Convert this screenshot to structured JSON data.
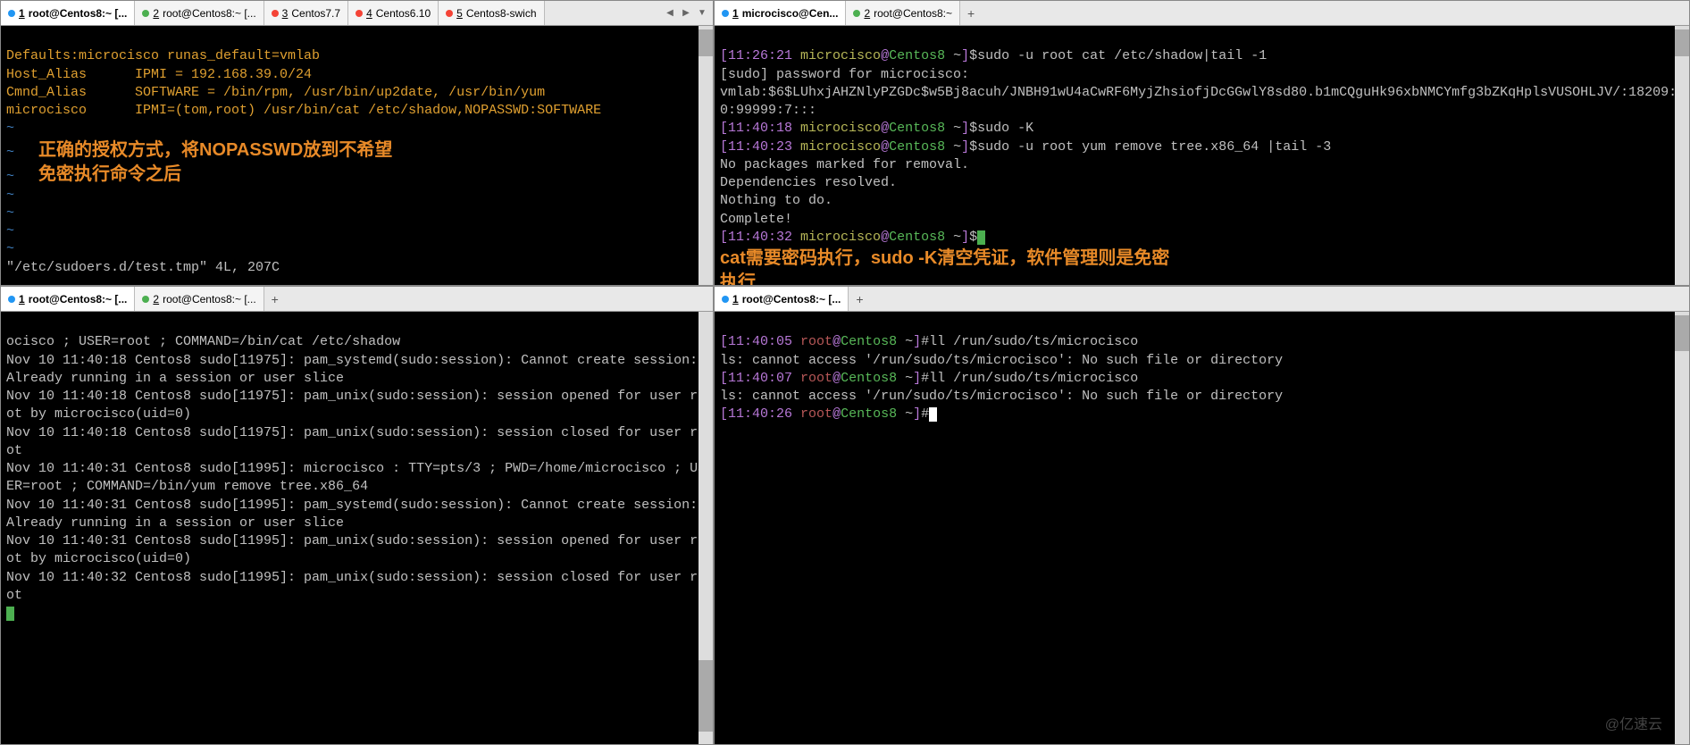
{
  "panes": {
    "tl": {
      "tabs": [
        {
          "dot": "blue",
          "num": "1",
          "label": "root@Centos8:~ [...",
          "active": true
        },
        {
          "dot": "green",
          "num": "2",
          "label": "root@Centos8:~ [..."
        },
        {
          "dot": "red",
          "num": "3",
          "label": "Centos7.7"
        },
        {
          "dot": "red",
          "num": "4",
          "label": "Centos6.10"
        },
        {
          "dot": "red",
          "num": "5",
          "label": "Centos8-swich"
        }
      ],
      "line1": "Defaults:microcisco runas_default=vmlab",
      "line2": "Host_Alias      IPMI = 192.168.39.0/24",
      "line3": "Cmnd_Alias      SOFTWARE = /bin/rpm, /usr/bin/up2date, /usr/bin/yum",
      "line4": "microcisco      IPMI=(tom,root) /usr/bin/cat /etc/shadow,NOPASSWD:SOFTWARE",
      "overlay1": "正确的授权方式，将NOPASSWD放到不希望",
      "overlay2": "免密执行命令之后",
      "footer": "\"/etc/sudoers.d/test.tmp\" 4L, 207C"
    },
    "tr": {
      "tabs": [
        {
          "dot": "blue",
          "num": "1",
          "label": "microcisco@Cen...",
          "active": true
        },
        {
          "dot": "green",
          "num": "2",
          "label": "root@Centos8:~"
        }
      ],
      "p1": {
        "ts": "11:26:21",
        "user": "microcisco",
        "host": "Centos8",
        "path": "~",
        "cmd": "sudo -u root cat /etc/shadow|tail -1"
      },
      "l2": "[sudo] password for microcisco:",
      "l3": "vmlab:$6$LUhxjAHZNlyPZGDc$w5Bj8acuh/JNBH91wU4aCwRF6MyjZhsiofjDcGGwlY8sd80.b1mCQguHk96xbNMCYmfg3bZKqHplsVUSOHLJV/:18209:0:99999:7:::",
      "p4": {
        "ts": "11:40:18",
        "user": "microcisco",
        "host": "Centos8",
        "path": "~",
        "cmd": "sudo -K"
      },
      "p5": {
        "ts": "11:40:23",
        "user": "microcisco",
        "host": "Centos8",
        "path": "~",
        "cmd": "sudo -u root yum remove tree.x86_64 |tail -3"
      },
      "l6": "No packages marked for removal.",
      "l7": "Dependencies resolved.",
      "l8": "Nothing to do.",
      "l9": "Complete!",
      "p10": {
        "ts": "11:40:32",
        "user": "microcisco",
        "host": "Centos8",
        "path": "~"
      },
      "overlay1": "cat需要密码执行，sudo -K清空凭证，软件管理则是免密",
      "overlay2": "执行"
    },
    "bl": {
      "tabs": [
        {
          "dot": "blue",
          "num": "1",
          "label": "root@Centos8:~ [...",
          "active": true
        },
        {
          "dot": "green",
          "num": "2",
          "label": "root@Centos8:~ [..."
        }
      ],
      "lines": [
        "ocisco ; USER=root ; COMMAND=/bin/cat /etc/shadow",
        "Nov 10 11:40:18 Centos8 sudo[11975]: pam_systemd(sudo:session): Cannot create session: Already running in a session or user slice",
        "Nov 10 11:40:18 Centos8 sudo[11975]: pam_unix(sudo:session): session opened for user root by microcisco(uid=0)",
        "Nov 10 11:40:18 Centos8 sudo[11975]: pam_unix(sudo:session): session closed for user root",
        "Nov 10 11:40:31 Centos8 sudo[11995]: microcisco : TTY=pts/3 ; PWD=/home/microcisco ; USER=root ; COMMAND=/bin/yum remove tree.x86_64",
        "Nov 10 11:40:31 Centos8 sudo[11995]: pam_systemd(sudo:session): Cannot create session: Already running in a session or user slice",
        "Nov 10 11:40:31 Centos8 sudo[11995]: pam_unix(sudo:session): session opened for user root by microcisco(uid=0)",
        "Nov 10 11:40:32 Centos8 sudo[11995]: pam_unix(sudo:session): session closed for user root"
      ]
    },
    "br": {
      "tabs": [
        {
          "dot": "blue",
          "num": "1",
          "label": "root@Centos8:~ [...",
          "active": true
        }
      ],
      "p1": {
        "ts": "11:40:05",
        "user": "root",
        "host": "Centos8",
        "path": "~",
        "cmd": "ll /run/sudo/ts/microcisco"
      },
      "l2": "ls: cannot access '/run/sudo/ts/microcisco': No such file or directory",
      "p3": {
        "ts": "11:40:07",
        "user": "root",
        "host": "Centos8",
        "path": "~",
        "cmd": "ll /run/sudo/ts/microcisco"
      },
      "l4": "ls: cannot access '/run/sudo/ts/microcisco': No such file or directory",
      "p5": {
        "ts": "11:40:26",
        "user": "root",
        "host": "Centos8",
        "path": "~"
      },
      "watermark": "@亿速云"
    }
  }
}
